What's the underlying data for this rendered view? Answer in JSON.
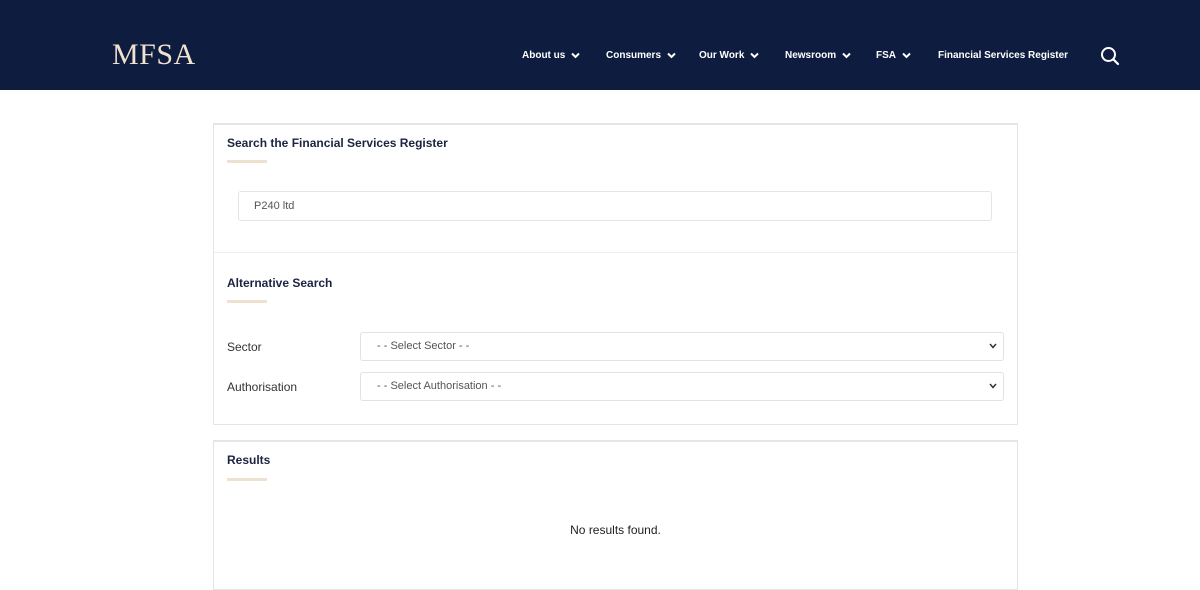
{
  "header": {
    "logo": "MFSA",
    "nav": [
      {
        "label": "About us",
        "has_dropdown": true
      },
      {
        "label": "Consumers",
        "has_dropdown": true
      },
      {
        "label": "Our Work",
        "has_dropdown": true
      },
      {
        "label": "Newsroom",
        "has_dropdown": true
      },
      {
        "label": "FSA",
        "has_dropdown": true
      },
      {
        "label": "Financial Services Register",
        "has_dropdown": false
      }
    ],
    "search_icon": "search-icon"
  },
  "search": {
    "title": "Search the Financial Services Register",
    "input_value": "P240 ltd"
  },
  "alternative": {
    "title": "Alternative Search",
    "sector_label": "Sector",
    "sector_selected": "- - Select Sector - -",
    "authorisation_label": "Authorisation",
    "authorisation_selected": "- - Select Authorisation - -"
  },
  "results": {
    "title": "Results",
    "message": "No results found."
  },
  "colors": {
    "header_bg": "#0e1c3f",
    "logo": "#f0e2cf",
    "accent_underline": "#efe1cf"
  }
}
